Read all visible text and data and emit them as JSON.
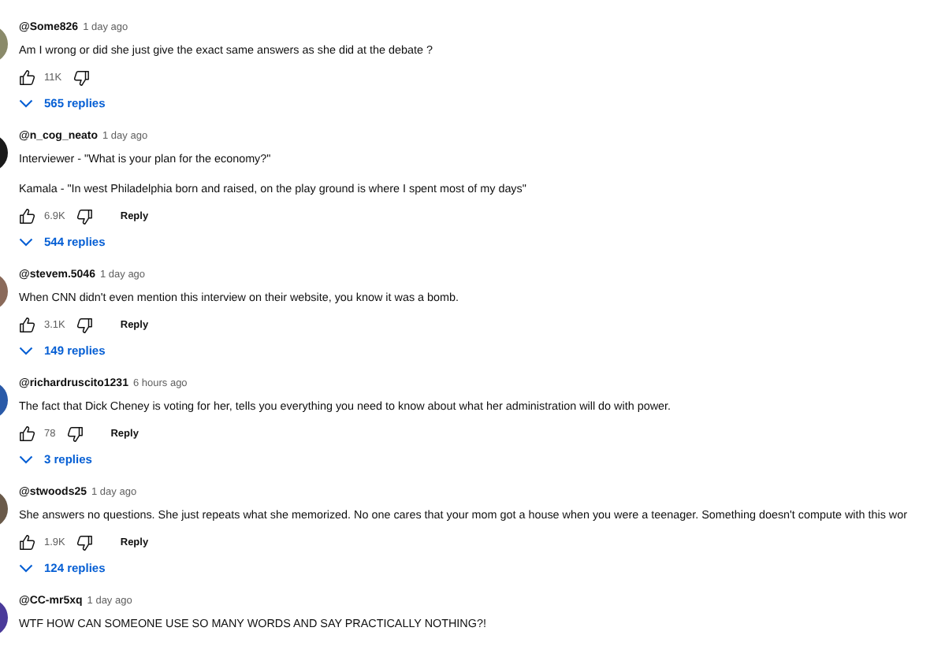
{
  "comments": [
    {
      "author": "@Some826",
      "time": "1 day ago",
      "color": "#8a8a6a",
      "paragraphs": [
        "Am I wrong or did she just give the exact same answers as she did at the debate ?"
      ],
      "likes": "11K",
      "replies": "565 replies"
    },
    {
      "author": "@n_cog_neato",
      "time": "1 day ago",
      "color": "#1a1a1a",
      "paragraphs": [
        "Interviewer - \"What is your plan for the economy?\"",
        "Kamala - \"In west Philadelphia born and raised, on the play ground is where I spent most of my days\""
      ],
      "likes": "6.9K",
      "reply_button": "Reply",
      "replies": "544 replies"
    },
    {
      "author": "@stevem.5046",
      "time": "1 day ago",
      "color": "#8a6a5a",
      "paragraphs": [
        "When CNN didn't even mention this interview on their website, you know it was a bomb."
      ],
      "likes": "3.1K",
      "reply_button": "Reply",
      "replies": "149 replies"
    },
    {
      "author": "@richardruscito1231",
      "time": "6 hours ago",
      "color": "#2a5aa8",
      "paragraphs": [
        "The fact that Dick Cheney is voting for her, tells you everything you need to know about what her administration will do with power."
      ],
      "likes": "78",
      "reply_button": "Reply",
      "replies": "3 replies"
    },
    {
      "author": "@stwoods25",
      "time": "1 day ago",
      "color": "#6a5a4a",
      "paragraphs": [
        "She answers no questions. She just repeats what she memorized. No one cares that your mom got a house when you were a teenager. Something doesn't compute with this wor"
      ],
      "likes": "1.9K",
      "reply_button": "Reply",
      "replies": "124 replies"
    },
    {
      "author": "@CC-mr5xq",
      "time": "1 day ago",
      "color": "#4a3a9a",
      "paragraphs": [
        "WTF HOW CAN SOMEONE USE SO MANY WORDS AND SAY PRACTICALLY NOTHING?!"
      ]
    }
  ]
}
